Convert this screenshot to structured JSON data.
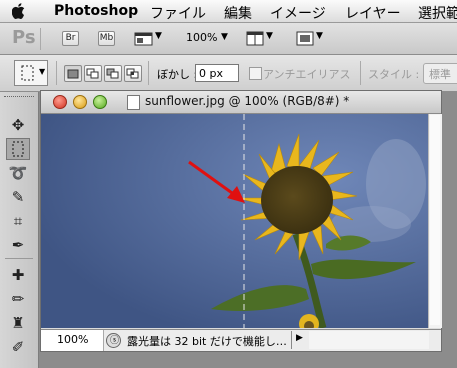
{
  "menubar": {
    "app_name": "Photoshop",
    "items": [
      "ファイル",
      "編集",
      "イメージ",
      "レイヤー",
      "選択範"
    ]
  },
  "appbar": {
    "ps_logo": "Ps",
    "br_label": "Br",
    "mb_label": "Mb",
    "zoom": "100%"
  },
  "options": {
    "feather_label": "ぼかし :",
    "feather_value": "0 px",
    "antialias_label": "アンチエイリアス",
    "style_label": "スタイル :",
    "style_value": "標準"
  },
  "document": {
    "title": "sunflower.jpg @ 100% (RGB/8#) *",
    "zoom": "100%",
    "status": "露光量は 32 bit だけで機能し…"
  },
  "icons": {
    "apple": "apple-icon",
    "marquee": "rect-marquee-icon"
  }
}
